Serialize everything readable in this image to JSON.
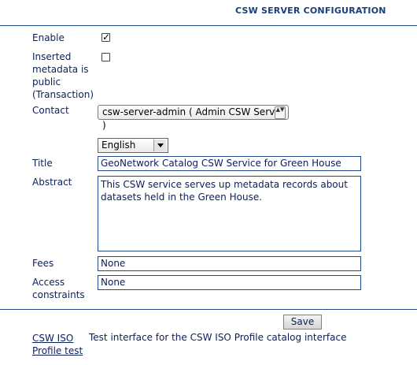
{
  "header": {
    "title": "CSW SERVER CONFIGURATION"
  },
  "form": {
    "enable": {
      "label": "Enable",
      "checked": true
    },
    "inserted_public": {
      "label": "Inserted\nmetadata is\npublic\n(Transaction)",
      "checked": false
    },
    "contact": {
      "label": "Contact",
      "selected": "csw-server-admin ( Admin CSW Server )"
    },
    "language": {
      "selected": "English"
    },
    "title": {
      "label": "Title",
      "value": "GeoNetwork Catalog CSW Service for Green House"
    },
    "abstract": {
      "label": "Abstract",
      "value": "This CSW service serves up metadata records about\ndatasets held in the Green House."
    },
    "fees": {
      "label": "Fees",
      "value": "None"
    },
    "access_constraints": {
      "label": "Access\nconstraints",
      "value": "None"
    }
  },
  "actions": {
    "save_label": "Save"
  },
  "footer": {
    "link_label": "CSW ISO\nProfile test",
    "link_description": "Test interface for the CSW ISO Profile catalog interface"
  },
  "icons": {
    "checkmark": "✓",
    "select_caret": "▲▼"
  }
}
